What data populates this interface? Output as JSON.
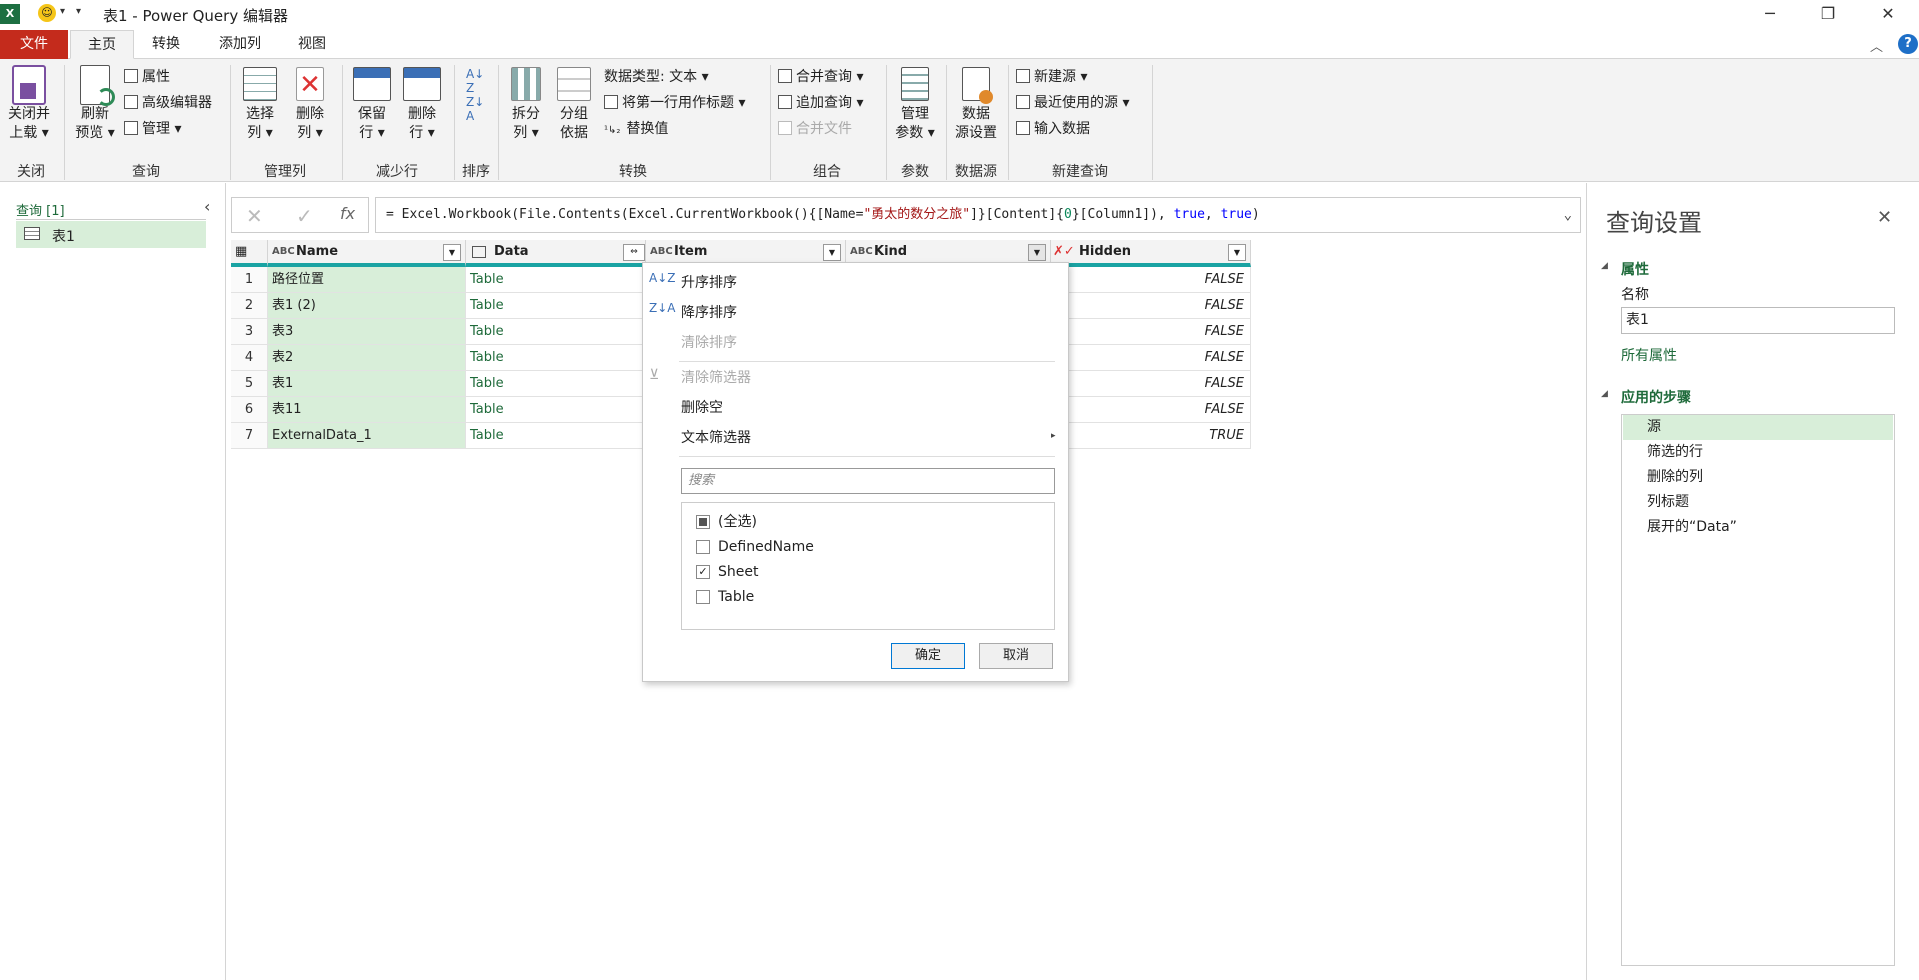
{
  "titlebar": {
    "title": "表1 - Power Query 编辑器",
    "app_icon": "X",
    "minimize": "─",
    "restore": "❐",
    "close": "✕"
  },
  "tabs": {
    "file": "文件",
    "home": "主页",
    "transform": "转换",
    "add_column": "添加列",
    "view": "视图"
  },
  "ribbon": {
    "close_load": "关闭并\n上载",
    "close_load_l1": "关闭并",
    "close_load_l2": "上载 ▾",
    "refresh_l1": "刷新",
    "refresh_l2": "预览 ▾",
    "properties": "属性",
    "advanced_editor": "高级编辑器",
    "manage": "管理 ▾",
    "choose_cols_l1": "选择",
    "choose_cols_l2": "列 ▾",
    "remove_cols_l1": "删除",
    "remove_cols_l2": "列 ▾",
    "keep_rows_l1": "保留",
    "keep_rows_l2": "行 ▾",
    "remove_rows_l1": "删除",
    "remove_rows_l2": "行 ▾",
    "split_l1": "拆分",
    "split_l2": "列 ▾",
    "group_l1": "分组",
    "group_l2": "依据",
    "data_type": "数据类型: 文本 ▾",
    "first_row_header": "将第一行用作标题 ▾",
    "replace_values": "替换值",
    "merge_queries": "合并查询 ▾",
    "append_queries": "追加查询 ▾",
    "combine_files": "合并文件",
    "manage_params_l1": "管理",
    "manage_params_l2": "参数 ▾",
    "data_source_l1": "数据",
    "data_source_l2": "源设置",
    "new_source": "新建源 ▾",
    "recent_sources": "最近使用的源 ▾",
    "enter_data": "输入数据",
    "groups": {
      "close": "关闭",
      "query": "查询",
      "manage_cols": "管理列",
      "reduce_rows": "减少行",
      "sort": "排序",
      "transform": "转换",
      "combine": "组合",
      "params": "参数",
      "data_source": "数据源",
      "new_query": "新建查询"
    }
  },
  "leftpane": {
    "header": "查询 [1]",
    "query": "表1"
  },
  "formula": {
    "prefix": "= Excel.Workbook(File.Contents(Excel.CurrentWorkbook(){[Name=",
    "string": "\"勇太的数分之旅\"",
    "mid": "]}[Content]{",
    "zero": "0",
    "mid2": "}[Column1]), ",
    "t1": "true",
    ",": ", ",
    "t2": "true",
    "end": ")"
  },
  "grid": {
    "columns": [
      "Name",
      "Data",
      "Item",
      "Kind",
      "Hidden"
    ],
    "rows": [
      {
        "n": "1",
        "name": "路径位置",
        "data": "Table",
        "hidden": "FALSE"
      },
      {
        "n": "2",
        "name": "表1 (2)",
        "data": "Table",
        "hidden": "FALSE"
      },
      {
        "n": "3",
        "name": "表3",
        "data": "Table",
        "hidden": "FALSE"
      },
      {
        "n": "4",
        "name": "表2",
        "data": "Table",
        "hidden": "FALSE"
      },
      {
        "n": "5",
        "name": "表1",
        "data": "Table",
        "hidden": "FALSE"
      },
      {
        "n": "6",
        "name": "表11",
        "data": "Table",
        "hidden": "FALSE"
      },
      {
        "n": "7",
        "name": "ExternalData_1",
        "data": "Table",
        "hidden": "TRUE"
      }
    ]
  },
  "popup": {
    "sort_asc": "升序排序",
    "sort_desc": "降序排序",
    "clear_sort": "清除排序",
    "clear_filter": "清除筛选器",
    "remove_empty": "删除空",
    "text_filters": "文本筛选器",
    "search_placeholder": "搜索",
    "items": [
      {
        "label": "(全选)",
        "state": "partial"
      },
      {
        "label": "DefinedName",
        "state": "off"
      },
      {
        "label": "Sheet",
        "state": "on"
      },
      {
        "label": "Table",
        "state": "off"
      }
    ],
    "ok": "确定",
    "cancel": "取消"
  },
  "rightpane": {
    "title": "查询设置",
    "properties": "属性",
    "name_label": "名称",
    "name_value": "表1",
    "all_props": "所有属性",
    "applied_steps": "应用的步骤",
    "steps": [
      "源",
      "筛选的行",
      "删除的列",
      "列标题",
      "展开的“Data”"
    ]
  },
  "colors": {
    "accent": "#217346",
    "teal": "#1aa3a3",
    "file_red": "#c42b1c",
    "selected": "#d8eed9"
  }
}
